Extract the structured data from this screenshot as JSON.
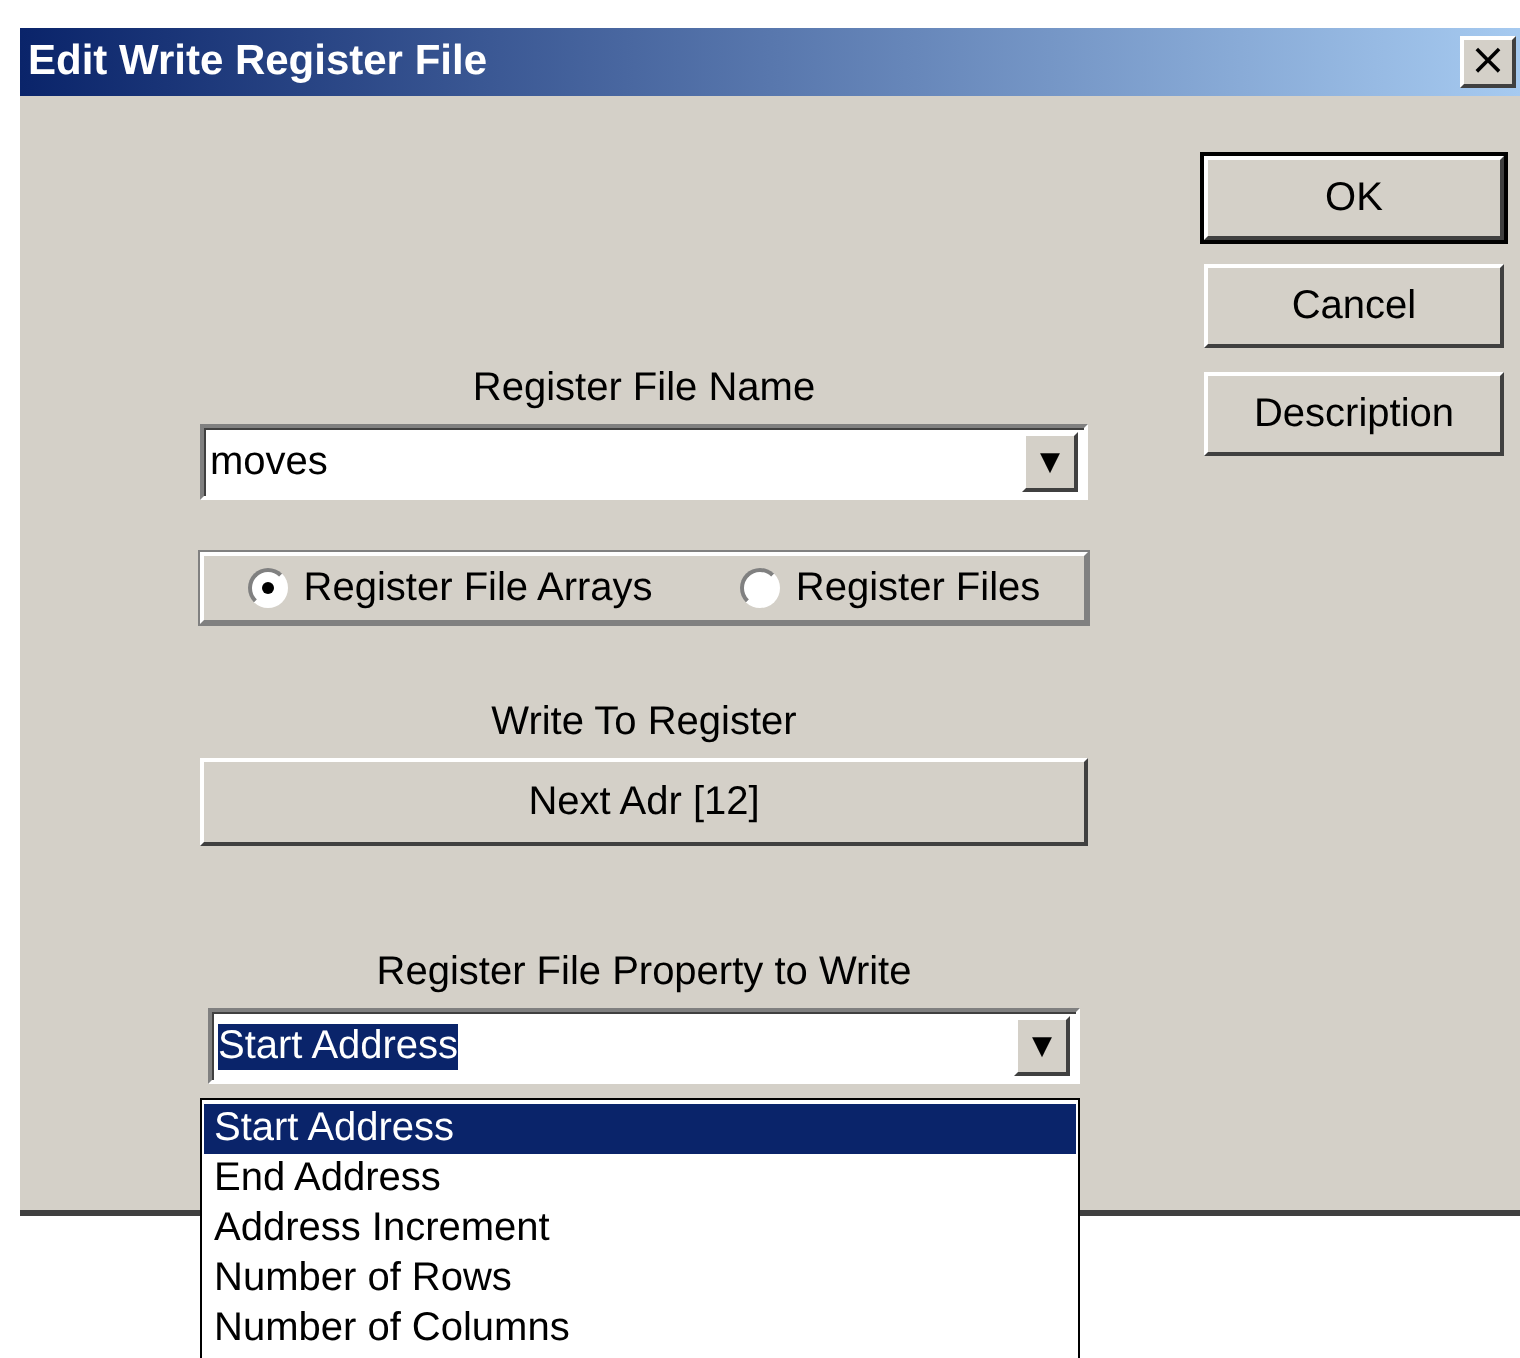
{
  "window": {
    "title": "Edit Write Register File",
    "close": "×"
  },
  "buttons": [
    {
      "label": "OK",
      "default": true
    },
    {
      "label": "Cancel",
      "default": false
    },
    {
      "label": "Description",
      "default": false
    }
  ],
  "register_file_name": {
    "label": "Register File Name",
    "value": "moves",
    "arrow": "▼"
  },
  "source": [
    {
      "label": "Register File Arrays",
      "selected": true
    },
    {
      "label": "Register Files",
      "selected": false
    }
  ],
  "write_to_register": {
    "label": "Write To Register",
    "button": "Next Adr [12]"
  },
  "property": {
    "label": "Register File Property to Write",
    "value": "Start Address",
    "arrow": "▼",
    "options": [
      {
        "label": "Start Address",
        "selected": true
      },
      {
        "label": "End Address",
        "selected": false
      },
      {
        "label": "Address Increment",
        "selected": false
      },
      {
        "label": "Number of Rows",
        "selected": false
      },
      {
        "label": "Number of Columns",
        "selected": false
      }
    ]
  }
}
